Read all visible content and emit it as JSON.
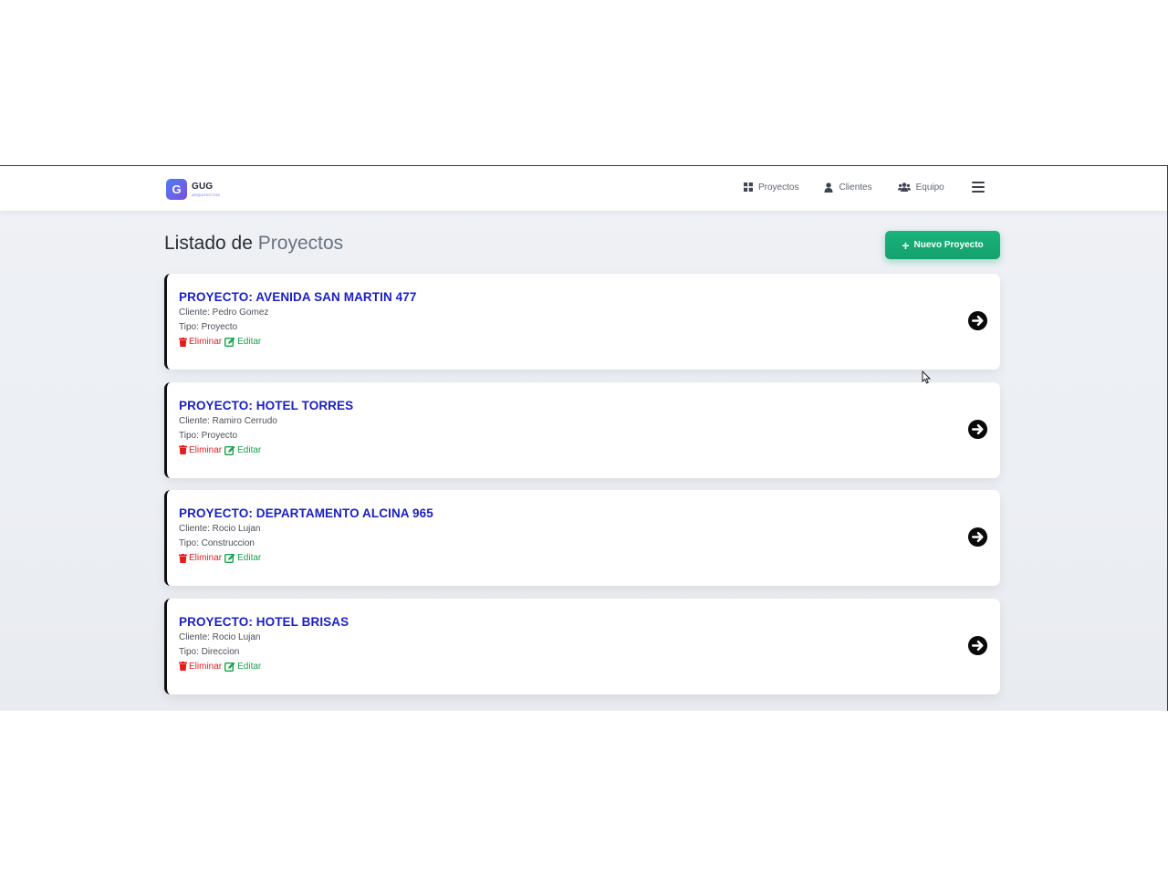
{
  "brand": {
    "mark": "G",
    "name": "GUG",
    "sub": "ARQUITECTOS"
  },
  "nav": {
    "items": [
      {
        "label": "Proyectos",
        "icon": "grid-icon"
      },
      {
        "label": "Clientes",
        "icon": "user-icon"
      },
      {
        "label": "Equipo",
        "icon": "users-icon"
      }
    ],
    "menu_icon": "hamburger-icon"
  },
  "page": {
    "title_main": "Listado de",
    "title_muted": "Proyectos"
  },
  "new_button": {
    "label": "Nuevo Proyecto",
    "icon": "plus-icon",
    "color": "#14a06d"
  },
  "projects": [
    {
      "title": "PROYECTO: AVENIDA SAN MARTIN 477",
      "client": "Cliente: Pedro Gomez",
      "type": "Tipo: Proyecto",
      "delete_label": "Eliminar",
      "edit_label": "Editar"
    },
    {
      "title": "PROYECTO: HOTEL TORRES",
      "client": "Cliente: Ramiro Cerrudo",
      "type": "Tipo: Proyecto",
      "delete_label": "Eliminar",
      "edit_label": "Editar"
    },
    {
      "title": "PROYECTO: DEPARTAMENTO ALCINA 965",
      "client": "Cliente: Rocio Lujan",
      "type": "Tipo: Construccion",
      "delete_label": "Eliminar",
      "edit_label": "Editar"
    },
    {
      "title": "PROYECTO: HOTEL BRISAS",
      "client": "Cliente: Rocio Lujan",
      "type": "Tipo: Direccion",
      "delete_label": "Eliminar",
      "edit_label": "Editar"
    }
  ],
  "colors": {
    "title": "#1a1fc4",
    "delete": "#e11d1d",
    "edit": "#16a34a",
    "accent": "#7b4fe0"
  }
}
